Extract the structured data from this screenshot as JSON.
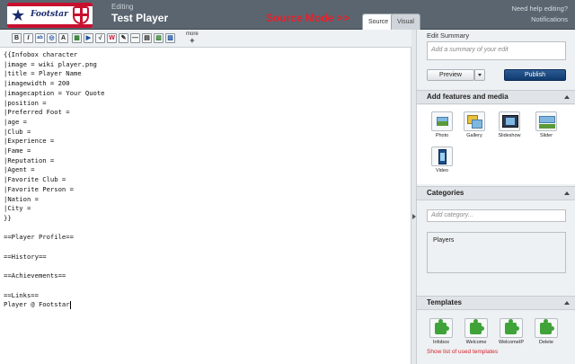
{
  "header": {
    "logo_text": "Footstar",
    "editing_label": "Editing",
    "page_title": "Test Player",
    "annotation": "Source Mode >>",
    "tabs": [
      {
        "label": "Source",
        "active": true
      },
      {
        "label": "Visual",
        "active": false
      }
    ],
    "help_link": "Need help editing?",
    "notifications_link": "Notifications"
  },
  "toolbar": {
    "buttons": [
      {
        "name": "bold-button",
        "glyph": "B"
      },
      {
        "name": "italic-button",
        "glyph": "I"
      },
      {
        "name": "internal-link-button",
        "glyph": "ab"
      },
      {
        "name": "external-link-button",
        "glyph": "◎"
      },
      {
        "name": "heading-button",
        "glyph": "A"
      },
      {
        "name": "image-button",
        "glyph": "▦"
      },
      {
        "name": "media-button",
        "glyph": "▶"
      },
      {
        "name": "math-button",
        "glyph": "√"
      },
      {
        "name": "nowiki-button",
        "glyph": "W"
      },
      {
        "name": "signature-button",
        "glyph": "✎"
      },
      {
        "name": "horizontal-line-button",
        "glyph": "—"
      },
      {
        "name": "table-button",
        "glyph": "▤"
      },
      {
        "name": "gallery-button",
        "glyph": "▧"
      },
      {
        "name": "slideshow-button",
        "glyph": "▨"
      }
    ],
    "more_label": "more",
    "more_glyph": "+"
  },
  "editor": {
    "lines": [
      "{{Infobox character",
      "|image = wiki player.png",
      "|title = Player Name",
      "|imagewidth = 200",
      "|imagecaption = Your Quote",
      "|position =",
      "|Preferred Foot =",
      "|age =",
      "|Club =",
      "|Experience =",
      "|Fame =",
      "|Reputation =",
      "|Agent =",
      "|Favorite Club =",
      "|Favorite Person =",
      "|Nation =",
      "|City =",
      "}}",
      "",
      "==Player Profile==",
      "",
      "==History==",
      "",
      "==Achievements==",
      "",
      "==Links==",
      "Player @ Footstar"
    ]
  },
  "rail": {
    "summary_heading": "Edit Summary",
    "summary_placeholder": "Add a summary of your edit",
    "preview_label": "Preview",
    "publish_label": "Publish",
    "media_section": {
      "title": "Add features and media",
      "items": [
        {
          "label": "Photo",
          "icon": "photo-icon"
        },
        {
          "label": "Gallery",
          "icon": "gallery-icon"
        },
        {
          "label": "Slideshow",
          "icon": "slideshow-icon"
        },
        {
          "label": "Slider",
          "icon": "slider-icon"
        },
        {
          "label": "Video",
          "icon": "video-icon"
        }
      ]
    },
    "categories_section": {
      "title": "Categories",
      "input_placeholder": "Add category...",
      "categories": [
        "Players"
      ]
    },
    "templates_section": {
      "title": "Templates",
      "items": [
        {
          "label": "Infobox",
          "icon": "puzzle-icon"
        },
        {
          "label": "Welcome",
          "icon": "puzzle-icon"
        },
        {
          "label": "WelcomeIP",
          "icon": "puzzle-icon"
        },
        {
          "label": "Delete",
          "icon": "puzzle-icon"
        }
      ],
      "show_list_link": "Show list of used templates"
    }
  },
  "colors": {
    "header_bg": "#5a6570",
    "annotation": "#e8202a",
    "publish": "#1a4a82",
    "template_icon": "#3fa33a",
    "link_red": "#d6202a"
  }
}
